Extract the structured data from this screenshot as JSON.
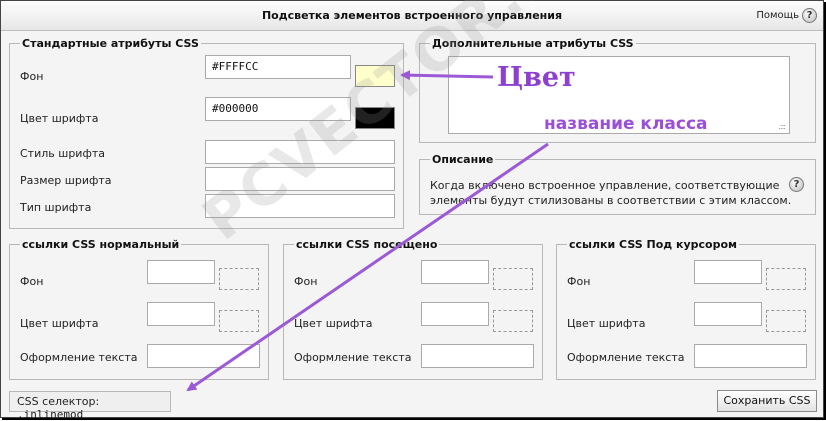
{
  "dialog": {
    "title": "Подсветка элементов встроенного управления",
    "help_label": "Помощь",
    "help_glyph": "?"
  },
  "standard": {
    "legend": "Стандартные атрибуты CSS",
    "background_label": "Фон",
    "background_value": "#FFFFCC",
    "background_swatch": "#FFFFCC",
    "font_color_label": "Цвет шрифта",
    "font_color_value": "#000000",
    "font_color_swatch": "#000000",
    "font_style_label": "Стиль шрифта",
    "font_size_label": "Размер шрифта",
    "font_type_label": "Тип шрифта"
  },
  "additional": {
    "legend": "Дополнительные атрибуты CSS"
  },
  "description": {
    "legend": "Описание",
    "text_line1": "Когда включено встроенное управление, соответствующие",
    "text_line2": "элементы будут стилизованы в соответствии с этим классом.",
    "help_glyph": "?"
  },
  "links": [
    {
      "legend": "ссылки CSS нормальный",
      "background_label": "Фон",
      "font_color_label": "Цвет шрифта",
      "decoration_label": "Оформление текста"
    },
    {
      "legend": "ссылки CSS посещено",
      "background_label": "Фон",
      "font_color_label": "Цвет шрифта",
      "decoration_label": "Оформление текста"
    },
    {
      "legend": "ссылки CSS Под курсором",
      "background_label": "Фон",
      "font_color_label": "Цвет шрифта",
      "decoration_label": "Оформление текста"
    }
  ],
  "footer": {
    "selector_label": "CSS селектор:",
    "selector_value": ".inlinemod",
    "save_label": "Сохранить CSS"
  },
  "annotations": {
    "color_label": "Цвет",
    "class_name_label": "название класса",
    "arrow_color": "#9b59d6"
  },
  "watermark": "PCVECTOR.RU"
}
